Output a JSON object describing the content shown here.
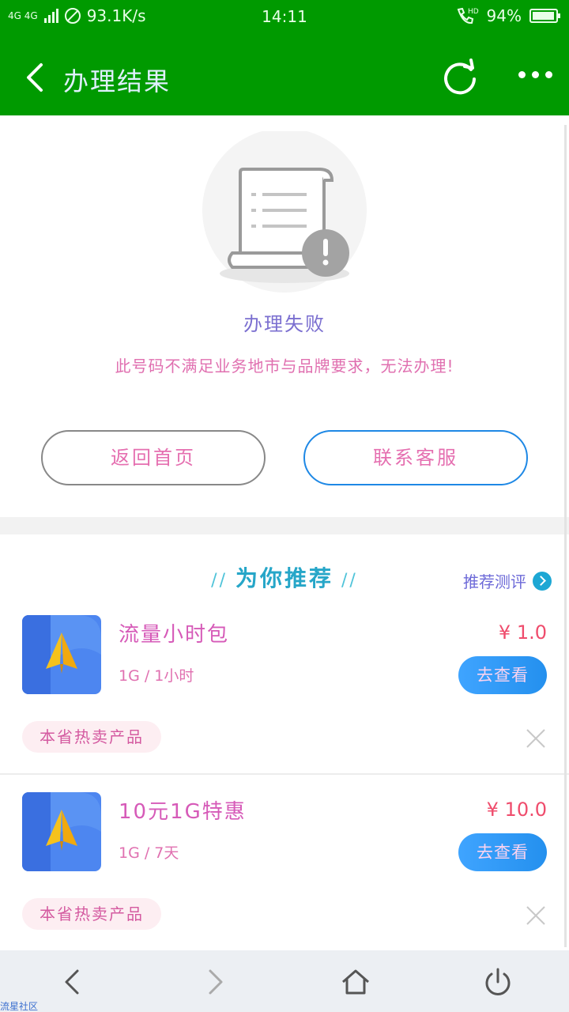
{
  "status_bar": {
    "signal": "4G 4G",
    "speed": "93.1K/s",
    "time": "14:11",
    "hd": "HD",
    "battery": "94%"
  },
  "header": {
    "title": "办理结果"
  },
  "result": {
    "title": "办理失败",
    "message": "此号码不满足业务地市与品牌要求，无法办理!",
    "home_button": "返回首页",
    "service_button": "联系客服"
  },
  "recommend": {
    "heading": "为你推荐",
    "review_link": "推荐测评",
    "items": [
      {
        "name": "流量小时包",
        "spec": "1G / 1小时",
        "price": "¥ 1.0",
        "view": "去查看",
        "tag": "本省热卖产品"
      },
      {
        "name": "10元1G特惠",
        "spec": "1G / 7天",
        "price": "¥ 10.0",
        "view": "去查看",
        "tag": "本省热卖产品"
      }
    ]
  },
  "watermark": "流星社区",
  "colors": {
    "header_green": "#009a00",
    "accent_blue": "#1e88e5",
    "price_red": "#ef4c6c"
  }
}
